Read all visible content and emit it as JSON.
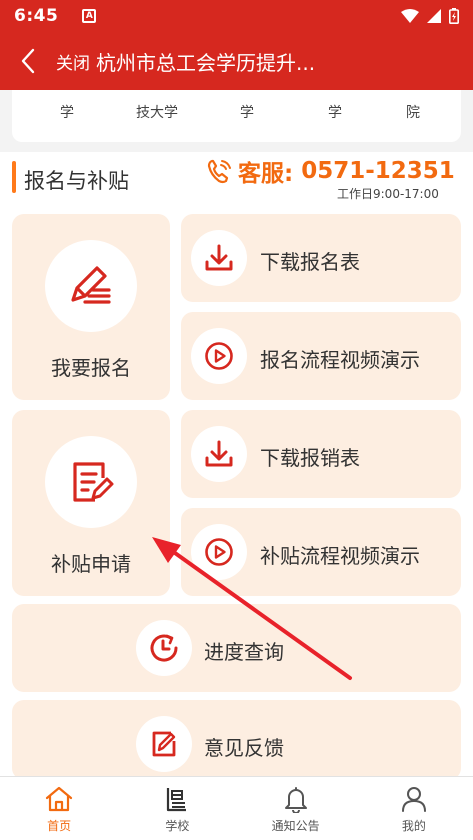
{
  "status_bar": {
    "time": "6:45",
    "notif_letter": "A"
  },
  "title_bar": {
    "close_label": "关闭",
    "title": "杭州市总工会学历提升..."
  },
  "school_strip": {
    "items": [
      "学",
      "技大学",
      "学",
      "学",
      "院"
    ]
  },
  "section": {
    "title": "报名与补贴",
    "hotline_label": "客服:",
    "hotline_number": "0571-12351",
    "hours": "工作日9:00-17:00"
  },
  "cards": {
    "signup": "我要报名",
    "subsidy": "补贴申请",
    "download_form": "下载报名表",
    "signup_video": "报名流程视频演示",
    "download_reimburse": "下载报销表",
    "subsidy_video": "补贴流程视频演示",
    "progress": "进度查询",
    "feedback": "意见反馈"
  },
  "colors": {
    "brand_red": "#d6281f",
    "accent_orange": "#f26a10",
    "card_bg": "#fdeee1"
  },
  "bottom_nav": {
    "items": [
      {
        "label": "首页",
        "icon": "home-icon",
        "active": true
      },
      {
        "label": "学校",
        "icon": "school-icon",
        "active": false
      },
      {
        "label": "通知公告",
        "icon": "bell-icon",
        "active": false
      },
      {
        "label": "我的",
        "icon": "user-icon",
        "active": false
      }
    ]
  }
}
